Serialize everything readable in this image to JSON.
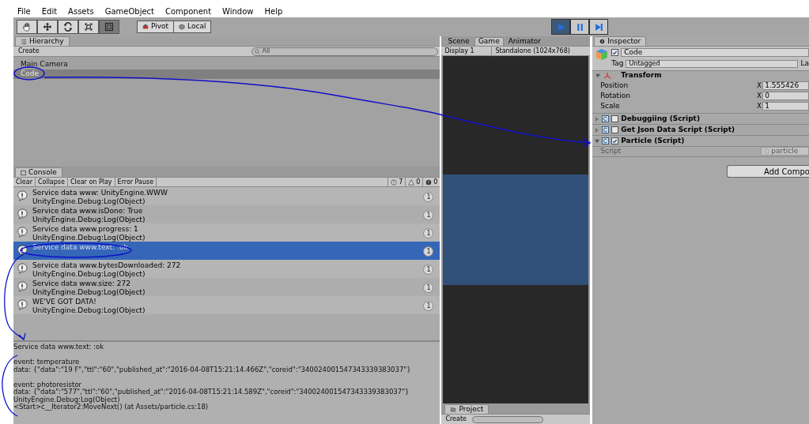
{
  "menu": [
    "File",
    "Edit",
    "Assets",
    "GameObject",
    "Component",
    "Window",
    "Help"
  ],
  "toolbar": {
    "tools": [
      {
        "kind": "hand",
        "selected": false
      },
      {
        "kind": "move",
        "selected": false
      },
      {
        "kind": "rotate",
        "selected": false
      },
      {
        "kind": "scale",
        "selected": false
      },
      {
        "kind": "rect",
        "selected": true
      }
    ],
    "pivot": "Pivot",
    "local": "Local",
    "playback": [
      {
        "kind": "play",
        "on": true
      },
      {
        "kind": "pause",
        "on": false
      },
      {
        "kind": "step",
        "on": false
      }
    ]
  },
  "hierarchy": {
    "title": "Hierarchy",
    "create": "Create",
    "search_placeholder": "All",
    "items": [
      {
        "label": "Main Camera",
        "selected": false
      },
      {
        "label": "Code",
        "selected": true
      }
    ]
  },
  "console": {
    "title": "Console",
    "buttons": [
      "Clear",
      "Collapse",
      "Clear on Play",
      "Error Pause"
    ],
    "counts": [
      {
        "kind": "info",
        "text": "7"
      },
      {
        "kind": "warning",
        "text": "0"
      },
      {
        "kind": "error",
        "text": "0"
      }
    ],
    "rows": [
      {
        "message": "Service data www: UnityEngine.WWW",
        "trace": "UnityEngine.Debug:Log(Object)",
        "count": "1",
        "selected": false
      },
      {
        "message": "Service data www.isDone: True",
        "trace": "UnityEngine.Debug:Log(Object)",
        "count": "1",
        "selected": false
      },
      {
        "message": "Service data www.progress: 1",
        "trace": "UnityEngine.Debug:Log(Object)",
        "count": "1",
        "selected": false
      },
      {
        "message": "Service data www.text: :ok",
        "count": "1",
        "selected": true
      },
      {
        "message": "Service data www.bytesDownloaded: 272",
        "trace": "UnityEngine.Debug:Log(Object)",
        "count": "1",
        "selected": false
      },
      {
        "message": "Service data www.size: 272",
        "trace": "UnityEngine.Debug:Log(Object)",
        "count": "1",
        "selected": false
      },
      {
        "message": "WE'VE GOT DATA!",
        "trace": "UnityEngine.Debug:Log(Object)",
        "count": "1",
        "selected": false
      }
    ],
    "detail": [
      [
        "Service data www.text: :ok"
      ],
      [
        "event: temperature",
        "data: {\"data\":\"19 F\",\"ttl\":\"60\",\"published_at\":\"2016-04-08T15:21:14.466Z\",\"coreid\":\"340024001547343339383037\"}"
      ],
      [
        "event: photoresistor",
        "data: {\"data\":\"577\",\"ttl\":\"60\",\"published_at\":\"2016-04-08T15:21:14.589Z\",\"coreid\":\"340024001547343339383037\"}",
        "UnityEngine.Debug:Log(Object)",
        "<Start>c__Iterator2:MoveNext() (at Assets/particle.cs:18)"
      ]
    ]
  },
  "view": {
    "tabs": [
      {
        "label": "Scene",
        "selected": false
      },
      {
        "label": "Game",
        "selected": true
      },
      {
        "label": "Animator",
        "selected": false
      }
    ],
    "display": "Display 1",
    "resolution": "Standalone (1024x768)"
  },
  "project": {
    "title": "Project",
    "create": "Create"
  },
  "inspector": {
    "title": "Inspector",
    "object": {
      "name": "Code",
      "active": true
    },
    "tag_label": "Tag",
    "tag": "Untagged",
    "layer_label": "La",
    "transform": {
      "title": "Transform",
      "rows": [
        {
          "label": "Position",
          "axis": "X",
          "value": "1.555426"
        },
        {
          "label": "Rotation",
          "axis": "X",
          "value": "0"
        },
        {
          "label": "Scale",
          "axis": "X",
          "value": "1"
        }
      ]
    },
    "components": [
      {
        "name": "Debuggiing (Script)",
        "checked": false,
        "expanded": false
      },
      {
        "name": "Get Json Data Script (Script)",
        "checked": false,
        "expanded": false
      },
      {
        "name": "Particle (Script)",
        "checked": true,
        "expanded": true,
        "field_label": "Script",
        "field_value": "particle"
      }
    ],
    "add_button": "Add Compo"
  }
}
